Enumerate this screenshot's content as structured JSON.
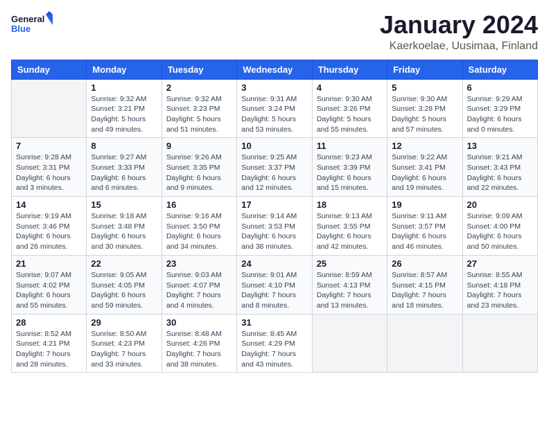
{
  "header": {
    "logo_line1": "General",
    "logo_line2": "Blue",
    "title": "January 2024",
    "subtitle": "Kaerkoelae, Uusimaa, Finland"
  },
  "calendar": {
    "days_of_week": [
      "Sunday",
      "Monday",
      "Tuesday",
      "Wednesday",
      "Thursday",
      "Friday",
      "Saturday"
    ],
    "weeks": [
      [
        {
          "day": "",
          "info": ""
        },
        {
          "day": "1",
          "info": "Sunrise: 9:32 AM\nSunset: 3:21 PM\nDaylight: 5 hours\nand 49 minutes."
        },
        {
          "day": "2",
          "info": "Sunrise: 9:32 AM\nSunset: 3:23 PM\nDaylight: 5 hours\nand 51 minutes."
        },
        {
          "day": "3",
          "info": "Sunrise: 9:31 AM\nSunset: 3:24 PM\nDaylight: 5 hours\nand 53 minutes."
        },
        {
          "day": "4",
          "info": "Sunrise: 9:30 AM\nSunset: 3:26 PM\nDaylight: 5 hours\nand 55 minutes."
        },
        {
          "day": "5",
          "info": "Sunrise: 9:30 AM\nSunset: 3:28 PM\nDaylight: 5 hours\nand 57 minutes."
        },
        {
          "day": "6",
          "info": "Sunrise: 9:29 AM\nSunset: 3:29 PM\nDaylight: 6 hours\nand 0 minutes."
        }
      ],
      [
        {
          "day": "7",
          "info": "Sunrise: 9:28 AM\nSunset: 3:31 PM\nDaylight: 6 hours\nand 3 minutes."
        },
        {
          "day": "8",
          "info": "Sunrise: 9:27 AM\nSunset: 3:33 PM\nDaylight: 6 hours\nand 6 minutes."
        },
        {
          "day": "9",
          "info": "Sunrise: 9:26 AM\nSunset: 3:35 PM\nDaylight: 6 hours\nand 9 minutes."
        },
        {
          "day": "10",
          "info": "Sunrise: 9:25 AM\nSunset: 3:37 PM\nDaylight: 6 hours\nand 12 minutes."
        },
        {
          "day": "11",
          "info": "Sunrise: 9:23 AM\nSunset: 3:39 PM\nDaylight: 6 hours\nand 15 minutes."
        },
        {
          "day": "12",
          "info": "Sunrise: 9:22 AM\nSunset: 3:41 PM\nDaylight: 6 hours\nand 19 minutes."
        },
        {
          "day": "13",
          "info": "Sunrise: 9:21 AM\nSunset: 3:43 PM\nDaylight: 6 hours\nand 22 minutes."
        }
      ],
      [
        {
          "day": "14",
          "info": "Sunrise: 9:19 AM\nSunset: 3:46 PM\nDaylight: 6 hours\nand 26 minutes."
        },
        {
          "day": "15",
          "info": "Sunrise: 9:18 AM\nSunset: 3:48 PM\nDaylight: 6 hours\nand 30 minutes."
        },
        {
          "day": "16",
          "info": "Sunrise: 9:16 AM\nSunset: 3:50 PM\nDaylight: 6 hours\nand 34 minutes."
        },
        {
          "day": "17",
          "info": "Sunrise: 9:14 AM\nSunset: 3:53 PM\nDaylight: 6 hours\nand 38 minutes."
        },
        {
          "day": "18",
          "info": "Sunrise: 9:13 AM\nSunset: 3:55 PM\nDaylight: 6 hours\nand 42 minutes."
        },
        {
          "day": "19",
          "info": "Sunrise: 9:11 AM\nSunset: 3:57 PM\nDaylight: 6 hours\nand 46 minutes."
        },
        {
          "day": "20",
          "info": "Sunrise: 9:09 AM\nSunset: 4:00 PM\nDaylight: 6 hours\nand 50 minutes."
        }
      ],
      [
        {
          "day": "21",
          "info": "Sunrise: 9:07 AM\nSunset: 4:02 PM\nDaylight: 6 hours\nand 55 minutes."
        },
        {
          "day": "22",
          "info": "Sunrise: 9:05 AM\nSunset: 4:05 PM\nDaylight: 6 hours\nand 59 minutes."
        },
        {
          "day": "23",
          "info": "Sunrise: 9:03 AM\nSunset: 4:07 PM\nDaylight: 7 hours\nand 4 minutes."
        },
        {
          "day": "24",
          "info": "Sunrise: 9:01 AM\nSunset: 4:10 PM\nDaylight: 7 hours\nand 8 minutes."
        },
        {
          "day": "25",
          "info": "Sunrise: 8:59 AM\nSunset: 4:13 PM\nDaylight: 7 hours\nand 13 minutes."
        },
        {
          "day": "26",
          "info": "Sunrise: 8:57 AM\nSunset: 4:15 PM\nDaylight: 7 hours\nand 18 minutes."
        },
        {
          "day": "27",
          "info": "Sunrise: 8:55 AM\nSunset: 4:18 PM\nDaylight: 7 hours\nand 23 minutes."
        }
      ],
      [
        {
          "day": "28",
          "info": "Sunrise: 8:52 AM\nSunset: 4:21 PM\nDaylight: 7 hours\nand 28 minutes."
        },
        {
          "day": "29",
          "info": "Sunrise: 8:50 AM\nSunset: 4:23 PM\nDaylight: 7 hours\nand 33 minutes."
        },
        {
          "day": "30",
          "info": "Sunrise: 8:48 AM\nSunset: 4:26 PM\nDaylight: 7 hours\nand 38 minutes."
        },
        {
          "day": "31",
          "info": "Sunrise: 8:45 AM\nSunset: 4:29 PM\nDaylight: 7 hours\nand 43 minutes."
        },
        {
          "day": "",
          "info": ""
        },
        {
          "day": "",
          "info": ""
        },
        {
          "day": "",
          "info": ""
        }
      ]
    ]
  }
}
